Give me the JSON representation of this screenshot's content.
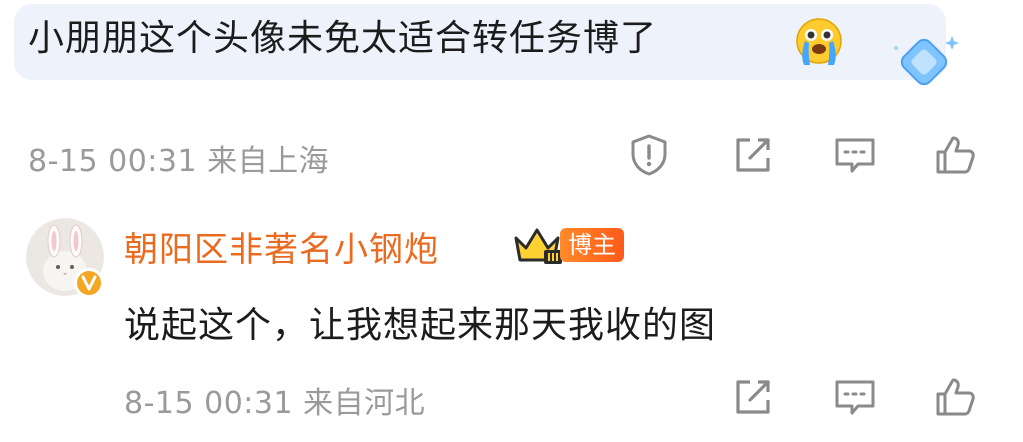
{
  "comment": {
    "text": "小朋朋这个头像未免太适合转任务博了",
    "emoji_icon": "crying-face-icon",
    "timestamp": "8-15 00:31",
    "location": "来自上海",
    "actions": [
      "report-icon",
      "repost-icon",
      "comment-icon",
      "like-icon"
    ]
  },
  "reply": {
    "username": "朝阳区非著名小钢炮",
    "badge_label": "博主",
    "text": "说起这个，让我想起来那天我收的图",
    "timestamp": "8-15 00:31",
    "location": "来自河北",
    "actions": [
      "repost-icon",
      "comment-icon",
      "like-icon"
    ]
  },
  "colors": {
    "bubble_bg": "#eef3fb",
    "username": "#ea6b1f",
    "meta": "#9a9a9a",
    "icon": "#8a8a8a"
  }
}
